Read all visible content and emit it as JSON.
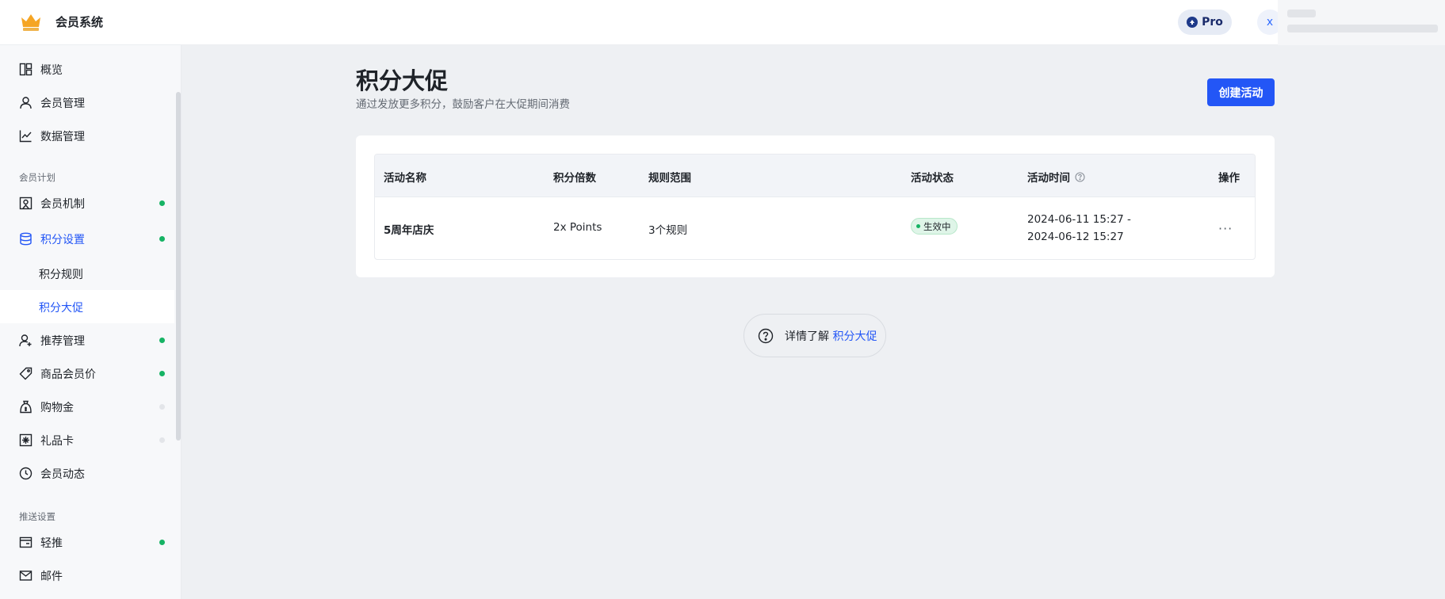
{
  "header": {
    "app_title": "会员系统",
    "pro_label": "Pro",
    "avatar_initial": "x"
  },
  "sidebar": {
    "items_top": [
      {
        "label": "概览",
        "icon": "dashboard-icon"
      },
      {
        "label": "会员管理",
        "icon": "user-icon"
      },
      {
        "label": "数据管理",
        "icon": "chart-line-icon"
      }
    ],
    "section_plan": "会员计划",
    "items_plan": [
      {
        "label": "会员机制",
        "icon": "badge-icon",
        "status": "green"
      },
      {
        "label": "积分设置",
        "icon": "database-icon",
        "status": "green",
        "active": true
      },
      {
        "label": "积分规则",
        "sub": true
      },
      {
        "label": "积分大促",
        "sub": true,
        "selected": true
      },
      {
        "label": "推荐管理",
        "icon": "user-add-icon",
        "status": "green"
      },
      {
        "label": "商品会员价",
        "icon": "tag-icon",
        "status": "green"
      },
      {
        "label": "购物金",
        "icon": "money-bag-icon",
        "status": "gray"
      },
      {
        "label": "礼品卡",
        "icon": "gift-card-icon",
        "status": "gray"
      },
      {
        "label": "会员动态",
        "icon": "clock-icon"
      }
    ],
    "section_push": "推送设置",
    "items_push": [
      {
        "label": "轻推",
        "icon": "message-box-icon",
        "status": "green"
      },
      {
        "label": "邮件",
        "icon": "mail-icon"
      }
    ]
  },
  "main": {
    "title": "积分大促",
    "subtitle": "通过发放更多积分，鼓励客户在大促期间消费",
    "create_button": "创建活动",
    "table": {
      "columns": [
        "活动名称",
        "积分倍数",
        "规则范围",
        "活动状态",
        "活动时间",
        "操作"
      ],
      "rows": [
        {
          "name": "5周年店庆",
          "multiplier": "2x Points",
          "rules": "3个规则",
          "status": "生效中",
          "time_start": "2024-06-11 15:27 -",
          "time_end": "2024-06-12 15:27",
          "action": "···"
        }
      ]
    },
    "learn_more": {
      "prefix": "详情了解",
      "link": "积分大促"
    }
  },
  "colors": {
    "accent": "#2356f6",
    "status_green": "#16b364",
    "background": "#eef0f3"
  }
}
